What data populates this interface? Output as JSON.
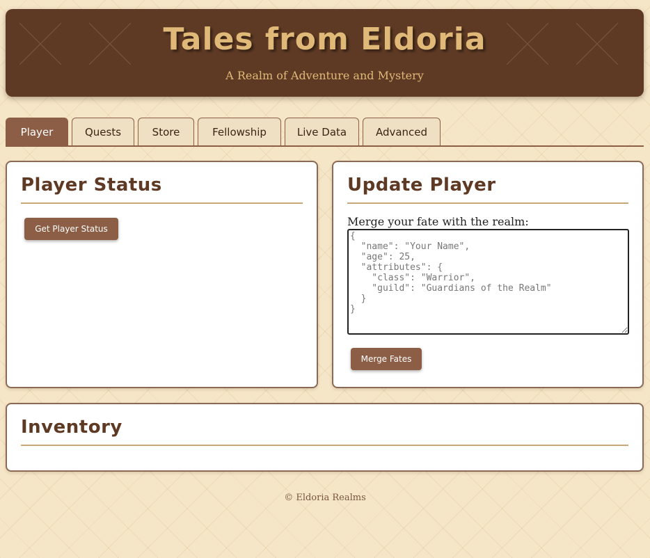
{
  "header": {
    "title": "Tales from Eldoria",
    "subtitle": "A Realm of Adventure and Mystery"
  },
  "tabs": [
    {
      "label": "Player",
      "active": true
    },
    {
      "label": "Quests",
      "active": false
    },
    {
      "label": "Store",
      "active": false
    },
    {
      "label": "Fellowship",
      "active": false
    },
    {
      "label": "Live Data",
      "active": false
    },
    {
      "label": "Advanced",
      "active": false
    }
  ],
  "player_status": {
    "title": "Player Status",
    "button_label": "Get Player Status"
  },
  "update_player": {
    "title": "Update Player",
    "field_label": "Merge your fate with the realm:",
    "placeholder": "{\n  \"name\": \"Your Name\",\n  \"age\": 25,\n  \"attributes\": {\n    \"class\": \"Warrior\",\n    \"guild\": \"Guardians of the Realm\"\n  }\n}",
    "button_label": "Merge Fates"
  },
  "inventory": {
    "title": "Inventory"
  },
  "footer": {
    "text": "© Eldoria Realms"
  },
  "colors": {
    "header_bg": "#5e3a24",
    "accent_gold": "#e0b878",
    "button_bg": "#8b5e45",
    "page_bg": "#f6e6c8"
  }
}
